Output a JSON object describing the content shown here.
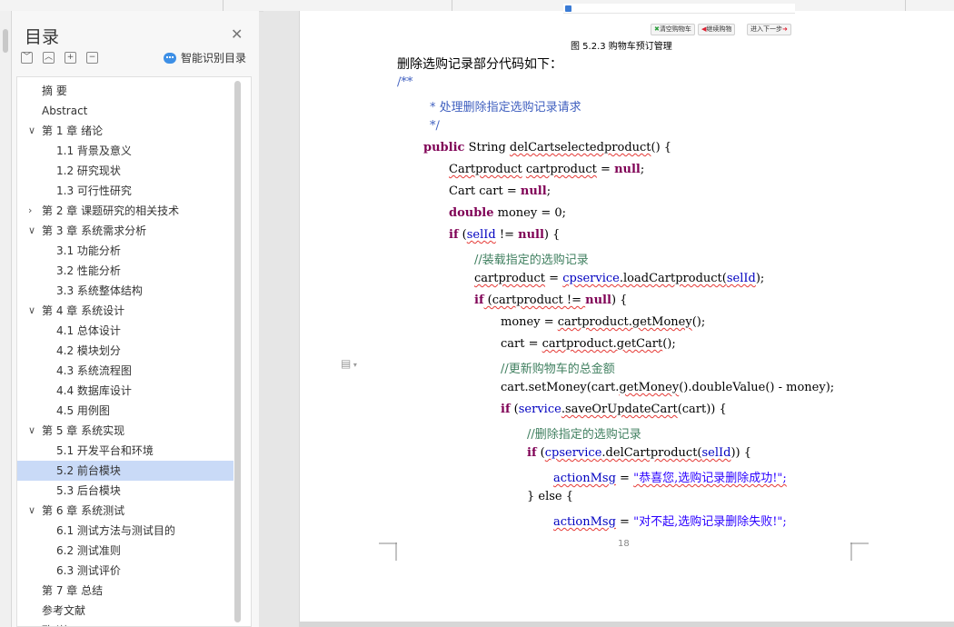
{
  "sidebar": {
    "title": "目录",
    "smart_label": "智能识别目录",
    "tools": [
      "﹀",
      "︿",
      "+",
      "−"
    ],
    "items": [
      {
        "label": "摘  要",
        "level": 1,
        "expandable": false
      },
      {
        "label": "Abstract",
        "level": 1,
        "expandable": false
      },
      {
        "label": "第 1 章  绪论",
        "level": 1,
        "expandable": true,
        "expanded": true
      },
      {
        "label": "1.1  背景及意义",
        "level": 2
      },
      {
        "label": "1.2  研究现状",
        "level": 2
      },
      {
        "label": "1.3  可行性研究",
        "level": 2
      },
      {
        "label": "第 2 章  课题研究的相关技术",
        "level": 1,
        "expandable": true,
        "expanded": false
      },
      {
        "label": "第 3 章  系统需求分析",
        "level": 1,
        "expandable": true,
        "expanded": true
      },
      {
        "label": "3.1  功能分析",
        "level": 2
      },
      {
        "label": "3.2  性能分析",
        "level": 2
      },
      {
        "label": "3.3  系统整体结构",
        "level": 2
      },
      {
        "label": "第 4 章  系统设计",
        "level": 1,
        "expandable": true,
        "expanded": true
      },
      {
        "label": "4.1  总体设计",
        "level": 2
      },
      {
        "label": "4.2  模块划分",
        "level": 2
      },
      {
        "label": "4.3 系统流程图",
        "level": 2
      },
      {
        "label": "4.4  数据库设计",
        "level": 2
      },
      {
        "label": "4.5  用例图",
        "level": 2
      },
      {
        "label": "第 5 章  系统实现",
        "level": 1,
        "expandable": true,
        "expanded": true
      },
      {
        "label": "5.1  开发平台和环境",
        "level": 2
      },
      {
        "label": "5.2  前台模块",
        "level": 2,
        "active": true
      },
      {
        "label": "5.3  后台模块",
        "level": 2
      },
      {
        "label": "第 6 章  系统测试",
        "level": 1,
        "expandable": true,
        "expanded": true
      },
      {
        "label": "6.1  测试方法与测试目的",
        "level": 2
      },
      {
        "label": "6.2  测试准则",
        "level": 2
      },
      {
        "label": "6.3  测试评价",
        "level": 2
      },
      {
        "label": "第 7 章  总结",
        "level": 1,
        "expandable": false
      },
      {
        "label": "参考文献",
        "level": 1,
        "expandable": false
      },
      {
        "label": "致  谢",
        "level": 1,
        "expandable": false
      }
    ]
  },
  "figure": {
    "buttons": [
      "清空购物车",
      "继续购物",
      "进入下一步"
    ],
    "caption": "图 5.2.3  购物车预订管理"
  },
  "document": {
    "intro": "删除选购记录部分代码如下：",
    "comment_open": "/**",
    "comment_body": "* 处理删除指定选购记录请求",
    "comment_close": "*/",
    "kw_public": "public",
    "method_sig_type": " String ",
    "method_name": "delCartselectedproduct",
    "method_tail": "() {",
    "l_cp_type": "Cartproduct",
    "l_cp_var": "cartproduct",
    "l_eq": " = ",
    "kw_null": "null",
    "semi": ";",
    "l_cart": "Cart cart = ",
    "kw_double": "double",
    "l_money": " money = 0;",
    "kw_if": "if",
    "l_selid": "selId",
    "l_neq": " != ",
    "l_close_brace": ") {",
    "c_load": "//装载指定的选购记录",
    "l_cpvar2": "cartproduct",
    "l_cpservice": "cpservice",
    "l_load": ".loadCartproduct(",
    "l_close_paren": ");",
    "l_if2_open": " (cartproduct != ",
    "l_money_assign": "money = ",
    "l_getmoney": "cartproduct.getMoney",
    "l_paren_semi": "();",
    "l_cart_assign": "cart = ",
    "l_getcart": "cartproduct.getCart",
    "c_update": "//更新购物车的总金额",
    "l_setmoney": "cart.setMoney(cart.",
    "l_getmoney2": "getMoney",
    "l_dv": "().doubleValue() - money);",
    "l_service": "service",
    "l_save": ".saveOrUpdateCart",
    "l_save_tail": "(cart)) {",
    "c_delete": "//删除指定的选购记录",
    "l_del": ".delCartproduct(",
    "l_del_tail": ")) {",
    "l_actionmsg": "actionMsg",
    "str_success": "\"恭喜您,选购记录删除成功!\";",
    "l_else": "} else {",
    "str_fail": "\"对不起,选购记录删除失败!\";",
    "page_number": "18"
  }
}
